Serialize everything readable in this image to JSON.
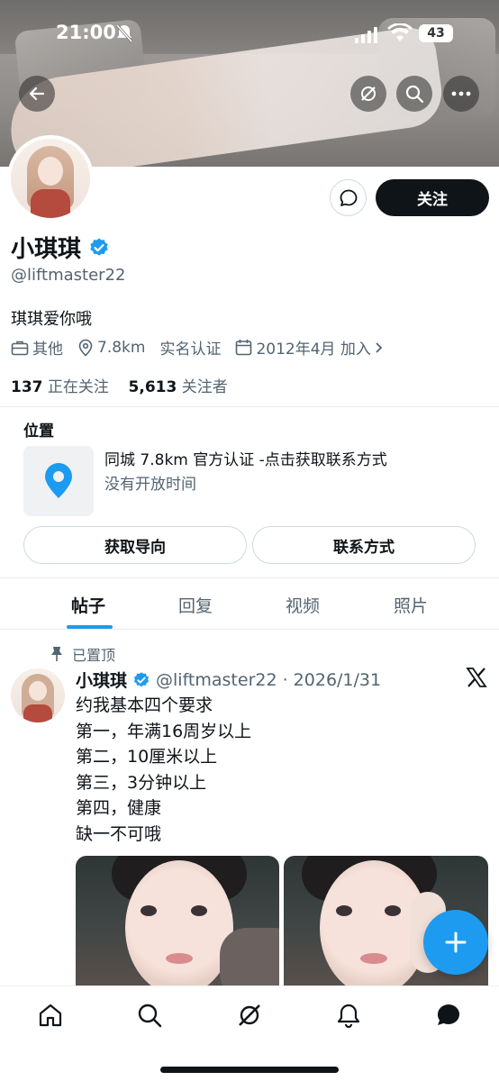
{
  "status_bar": {
    "time": "21:00",
    "battery": "43"
  },
  "profile": {
    "name": "小琪琪",
    "handle": "@liftmaster22",
    "bio": "琪琪爱你哦",
    "follow_label": "关注",
    "meta": {
      "category": "其他",
      "distance": "7.8km",
      "verification": "实名认证",
      "joined": "2012年4月 加入"
    },
    "following_count": "137",
    "following_label": "正在关注",
    "followers_count": "5,613",
    "followers_label": "关注者"
  },
  "location": {
    "title": "位置",
    "line1": "同城 7.8km 官方认证 -点击获取联系方式",
    "line2": "没有开放时间",
    "directions_label": "获取导向",
    "contact_label": "联系方式"
  },
  "tabs": [
    {
      "label": "帖子",
      "active": true
    },
    {
      "label": "回复",
      "active": false
    },
    {
      "label": "视频",
      "active": false
    },
    {
      "label": "照片",
      "active": false
    }
  ],
  "post": {
    "pinned_label": "已置顶",
    "author": "小琪琪",
    "handle_date": "@liftmaster22 · 2026/1/31",
    "lines": [
      "约我基本四个要求",
      "第一，年满16周岁以上",
      "第二，10厘米以上",
      "第三，3分钟以上",
      "第四，健康",
      "缺一不可哦"
    ]
  },
  "icons": {
    "back": "arrow-left-icon",
    "grok": "grok-icon",
    "search": "search-icon",
    "more": "more-icon",
    "message": "message-icon",
    "verified": "verified-badge-icon",
    "compose": "plus-icon"
  },
  "colors": {
    "accent": "#1d9bf0",
    "primary_button": "#0f1419",
    "secondary_text": "#536471"
  }
}
